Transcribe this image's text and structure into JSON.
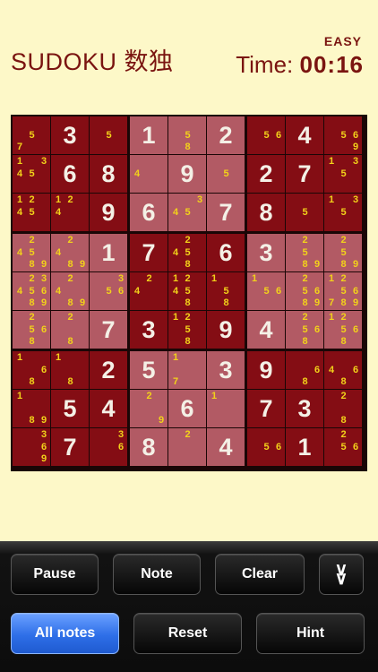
{
  "header": {
    "title": "SUDOKU 数独",
    "difficulty": "EASY",
    "time_label": "Time:",
    "time_value": "00:16"
  },
  "board": {
    "rows": [
      [
        {
          "n": [
            5,
            7
          ]
        },
        {
          "v": 3
        },
        {
          "n": [
            5
          ]
        },
        {
          "v": 1
        },
        {
          "n": [
            5,
            8
          ]
        },
        {
          "v": 2
        },
        {
          "n": [
            5,
            6
          ]
        },
        {
          "v": 4
        },
        {
          "n": [
            5,
            6,
            9
          ]
        }
      ],
      [
        {
          "n": [
            1,
            3,
            4,
            5
          ]
        },
        {
          "v": 6
        },
        {
          "v": 8
        },
        {
          "n": [
            4
          ]
        },
        {
          "v": 9
        },
        {
          "n": [
            5
          ]
        },
        {
          "v": 2
        },
        {
          "v": 7
        },
        {
          "n": [
            1,
            3,
            5
          ]
        }
      ],
      [
        {
          "n": [
            1,
            2,
            4,
            5
          ]
        },
        {
          "n": [
            1,
            2,
            4
          ]
        },
        {
          "v": 9
        },
        {
          "v": 6
        },
        {
          "n": [
            3,
            4,
            5
          ]
        },
        {
          "v": 7
        },
        {
          "v": 8
        },
        {
          "n": [
            5
          ]
        },
        {
          "n": [
            1,
            3,
            5
          ]
        }
      ],
      [
        {
          "n": [
            2,
            4,
            5,
            8,
            9
          ]
        },
        {
          "n": [
            2,
            4,
            8,
            9
          ]
        },
        {
          "v": 1
        },
        {
          "v": 7
        },
        {
          "n": [
            2,
            4,
            5,
            8
          ]
        },
        {
          "v": 6
        },
        {
          "v": 3
        },
        {
          "n": [
            2,
            5,
            8,
            9
          ]
        },
        {
          "n": [
            2,
            5,
            8,
            9
          ]
        }
      ],
      [
        {
          "n": [
            2,
            3,
            4,
            5,
            6,
            8,
            9
          ]
        },
        {
          "n": [
            2,
            4,
            8,
            9
          ]
        },
        {
          "n": [
            3,
            5,
            6
          ]
        },
        {
          "n": [
            2,
            4
          ]
        },
        {
          "n": [
            1,
            2,
            4,
            5,
            8
          ]
        },
        {
          "n": [
            1,
            5,
            8
          ]
        },
        {
          "n": [
            1,
            5,
            6
          ]
        },
        {
          "n": [
            2,
            5,
            6,
            8,
            9
          ]
        },
        {
          "n": [
            1,
            2,
            5,
            6,
            7,
            8,
            9
          ]
        }
      ],
      [
        {
          "n": [
            2,
            5,
            6,
            8
          ]
        },
        {
          "n": [
            2,
            8
          ]
        },
        {
          "v": 7
        },
        {
          "v": 3
        },
        {
          "n": [
            1,
            2,
            5,
            8
          ]
        },
        {
          "v": 9
        },
        {
          "v": 4
        },
        {
          "n": [
            2,
            5,
            6,
            8
          ]
        },
        {
          "n": [
            1,
            2,
            5,
            6,
            8
          ]
        }
      ],
      [
        {
          "n": [
            1,
            6,
            8
          ]
        },
        {
          "n": [
            1,
            8
          ]
        },
        {
          "v": 2
        },
        {
          "v": 5
        },
        {
          "n": [
            1,
            7
          ]
        },
        {
          "v": 3
        },
        {
          "v": 9
        },
        {
          "n": [
            6,
            8
          ]
        },
        {
          "n": [
            4,
            6,
            8
          ]
        }
      ],
      [
        {
          "n": [
            1,
            8,
            9
          ]
        },
        {
          "v": 5
        },
        {
          "v": 4
        },
        {
          "n": [
            2,
            9
          ]
        },
        {
          "v": 6
        },
        {
          "n": [
            1
          ]
        },
        {
          "v": 7
        },
        {
          "v": 3
        },
        {
          "n": [
            2,
            8
          ]
        }
      ],
      [
        {
          "n": [
            3,
            6,
            9
          ]
        },
        {
          "v": 7
        },
        {
          "n": [
            3,
            6
          ]
        },
        {
          "v": 8
        },
        {
          "n": [
            2
          ]
        },
        {
          "v": 4
        },
        {
          "n": [
            5,
            6
          ]
        },
        {
          "v": 1
        },
        {
          "n": [
            2,
            5,
            6
          ]
        }
      ]
    ]
  },
  "toolbar": {
    "pause": "Pause",
    "note": "Note",
    "clear": "Clear",
    "collapse_icon": "double-chevron-down",
    "all_notes": "All notes",
    "reset": "Reset",
    "hint": "Hint"
  },
  "colors": {
    "dark_cell": "#840d14",
    "light_cell": "#b25a64",
    "note": "#f2d21a",
    "value": "#f4f0e6",
    "active_button": "#2e6fe8"
  }
}
